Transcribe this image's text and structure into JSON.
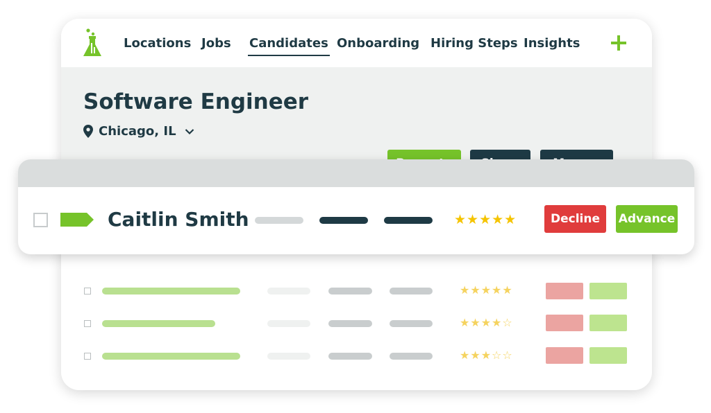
{
  "nav": {
    "items": [
      {
        "label": "Locations"
      },
      {
        "label": "Jobs"
      },
      {
        "label": "Candidates",
        "active": true
      },
      {
        "label": "Onboarding"
      },
      {
        "label": "Hiring Steps"
      },
      {
        "label": "Insights"
      }
    ],
    "plus_icon": "plus-icon",
    "logo_icon": "flask-logo-icon"
  },
  "job": {
    "title": "Software Engineer",
    "location": "Chicago, IL",
    "location_icon": "map-pin-icon",
    "actions": {
      "promote": "Promote",
      "share": "Share",
      "more": "More"
    }
  },
  "candidate": {
    "name": "Caitlin Smith",
    "rating": 5,
    "rating_max": 5,
    "decline_label": "Decline",
    "advance_label": "Advance"
  },
  "rows": [
    {
      "rating": 5
    },
    {
      "rating": 4
    },
    {
      "rating": 3
    }
  ],
  "colors": {
    "brand_green": "#76c32a",
    "dark_navy": "#1e3a45",
    "decline_red": "#e03c3c",
    "star_yellow": "#f5c400"
  }
}
